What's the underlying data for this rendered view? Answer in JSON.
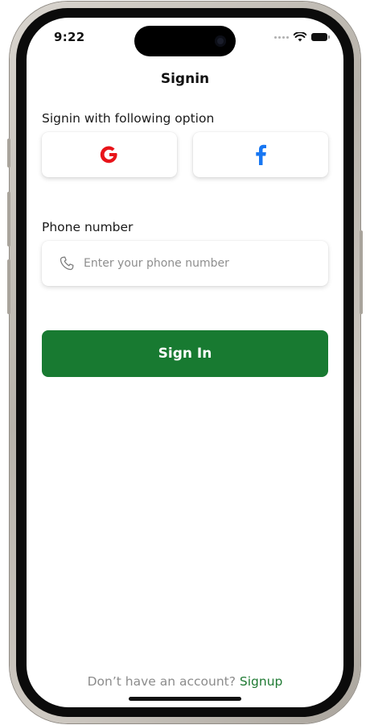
{
  "status_bar": {
    "time": "9:22"
  },
  "header": {
    "title": "Signin"
  },
  "social": {
    "label": "Signin with following option",
    "google_icon": "google-g-icon",
    "facebook_icon": "facebook-f-icon",
    "google_color": "#e8141a",
    "facebook_color": "#1877f2"
  },
  "phone": {
    "label": "Phone number",
    "placeholder": "Enter your phone number",
    "value": "",
    "icon": "phone-icon"
  },
  "actions": {
    "signin_label": "Sign In",
    "accent_color": "#187a31"
  },
  "footer": {
    "prompt": "Don’t have an account?",
    "signup_label": "Signup"
  }
}
